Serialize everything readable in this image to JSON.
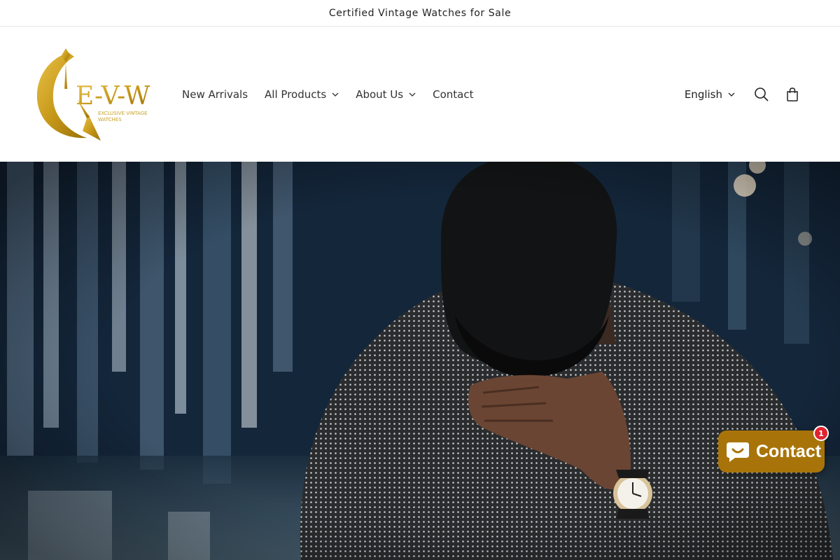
{
  "announcement": {
    "text": "Certified Vintage Watches for Sale"
  },
  "logo": {
    "text": "E-V-W",
    "tagline_line1": "EXCLUSIVE VINTAGE",
    "tagline_line2": "WATCHES",
    "color": "#c9a227"
  },
  "nav": {
    "items": [
      {
        "label": "New Arrivals",
        "icon": ""
      },
      {
        "label": "All Products",
        "icon": "chevron-down-icon"
      },
      {
        "label": "About Us",
        "icon": "chevron-down-icon"
      },
      {
        "label": "Contact",
        "icon": ""
      }
    ]
  },
  "header_right": {
    "language": "English",
    "search_icon": "search-icon",
    "cart_icon": "cart-icon"
  },
  "hero": {
    "image": "man-in-cap-dotted-shirt-wearing-wristwatch"
  },
  "chat": {
    "label": "Contact",
    "badge": "1",
    "color": "#a8740a",
    "badge_color": "#e0232f"
  }
}
